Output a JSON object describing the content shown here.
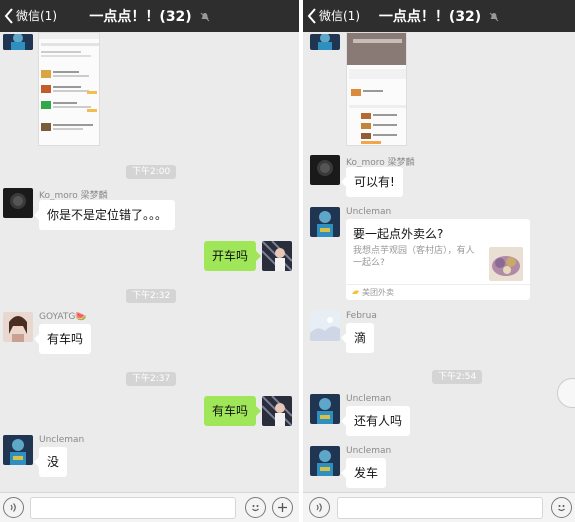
{
  "left": {
    "back_label": "微信(1)",
    "title": "一点点！！(32)",
    "time_200": "下午2:00",
    "time_232": "下午2:32",
    "time_237": "下午2:37",
    "ko_name": "Ko_moro 梁梦麟",
    "ko_msg": "你是不是定位错了。。。",
    "my_msg1": "开车吗",
    "goyatg_name": "GOYATG🍉",
    "goyatg_msg": "有车吗",
    "my_msg2": "有车吗",
    "uncleman_name": "Uncleman",
    "uncleman_msg": "没"
  },
  "right": {
    "back_label": "微信(1)",
    "title": "一点点！！(32)",
    "ko_name": "Ko_moro 梁梦麟",
    "ko_msg": "可以有!",
    "uncleman_name": "Uncleman",
    "card_title": "要一起点外卖么?",
    "card_desc": "我想点芋观园（客村店），有人一起么?",
    "card_source": "美团外卖",
    "februa_name": "Februa",
    "februa_msg": "滴",
    "time_254": "下午2:54",
    "uncleman_msg2": "还有人吗",
    "uncleman_msg3": "发车"
  },
  "colors": {
    "topbar": "#2e2e2e",
    "background": "#ebebeb",
    "out_bubble": "#9fe658"
  },
  "icons": [
    "back-chevron-icon",
    "mute-bell-icon",
    "group-members-icon",
    "voice-icon",
    "emoji-icon",
    "plus-icon",
    "meituan-icon"
  ]
}
